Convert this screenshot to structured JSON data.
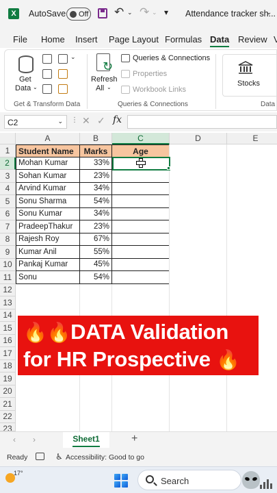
{
  "titlebar": {
    "app_icon": "X",
    "autosave_label": "AutoSave",
    "autosave_state": "Off",
    "document_title": "Attendance tracker sh..."
  },
  "menu": {
    "tabs": [
      "File",
      "Home",
      "Insert",
      "Page Layout",
      "Formulas",
      "Data",
      "Review",
      "V"
    ],
    "active_tab": "Data"
  },
  "ribbon": {
    "get_data_line1": "Get",
    "get_data_line2": "Data",
    "refresh_line1": "Refresh",
    "refresh_line2": "All",
    "queries_connections": "Queries & Connections",
    "properties": "Properties",
    "workbook_links": "Workbook Links",
    "stocks": "Stocks",
    "group_get_transform": "Get & Transform Data",
    "group_queries": "Queries & Connections",
    "group_data_types": "Data T"
  },
  "formula_bar": {
    "name_box": "C2",
    "fx": "fx",
    "value": ""
  },
  "grid": {
    "columns": [
      "A",
      "B",
      "C",
      "D",
      "E"
    ],
    "selected_column": "C",
    "rows": [
      "1",
      "2",
      "3",
      "4",
      "5",
      "6",
      "7",
      "8",
      "9",
      "10",
      "11",
      "12",
      "13",
      "14",
      "15",
      "16",
      "17",
      "18",
      "19",
      "20",
      "21",
      "22",
      "23"
    ],
    "selected_row": "2",
    "headers": [
      "Student Name",
      "Marks",
      "Age"
    ],
    "students": [
      {
        "name": "Mohan Kumar",
        "marks": "33%"
      },
      {
        "name": "Sohan Kumar",
        "marks": "23%"
      },
      {
        "name": "Arvind Kumar",
        "marks": "34%"
      },
      {
        "name": "Sonu Sharma",
        "marks": "54%"
      },
      {
        "name": "Sonu Kumar",
        "marks": "34%"
      },
      {
        "name": "PradeepThakur",
        "marks": "23%"
      },
      {
        "name": "Rajesh Roy",
        "marks": "67%"
      },
      {
        "name": "Kumar Anil",
        "marks": "55%"
      },
      {
        "name": "Pankaj Kumar",
        "marks": "45%"
      },
      {
        "name": "Sonu",
        "marks": "54%"
      }
    ]
  },
  "banner": {
    "line1": "DATA Validation",
    "line2": "for HR Prospective",
    "emoji": "🔥",
    "color": "#e8120f"
  },
  "sheets": {
    "tabs": [
      "Sheet1"
    ],
    "add_label": "+"
  },
  "status": {
    "ready": "Ready",
    "accessibility": "Accessibility: Good to go"
  },
  "taskbar": {
    "temperature": "17°",
    "search_placeholder": "Search"
  },
  "colors": {
    "accent": "#107c41",
    "header_fill": "#f7c59f"
  }
}
